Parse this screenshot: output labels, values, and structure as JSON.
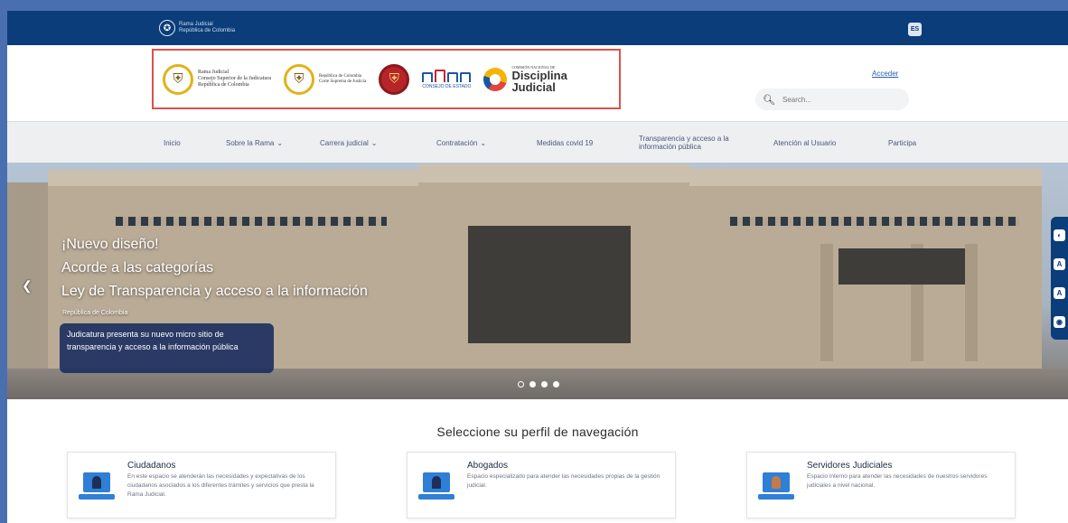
{
  "topbar": {
    "gov_logo_line1": "Rama Judicial",
    "gov_logo_line2": "República de Colombia",
    "lang": "ES"
  },
  "header": {
    "logo1_line1": "Rama Judicial",
    "logo1_line2": "Consejo Superior de la Judicatura",
    "logo1_line3": "República de Colombia",
    "logo2_line1": "República de Colombia",
    "logo2_line2": "Corte Suprema de Justicia",
    "logo4_text": "CONSEJO DE ESTADO",
    "logo5_small": "COMISIÓN NACIONAL DE",
    "logo5_big1": "Disciplina",
    "logo5_big2": "Judicial",
    "acceder": "Acceder",
    "search_placeholder": "Search..."
  },
  "nav": {
    "items": [
      {
        "label": "Inicio",
        "dropdown": false
      },
      {
        "label": "Sobre la Rama",
        "dropdown": true
      },
      {
        "label": "Carrera judicial",
        "dropdown": true
      },
      {
        "label": "Contratación",
        "dropdown": true
      },
      {
        "label": "Medidas covid 19",
        "dropdown": false
      },
      {
        "label": "Transparencia y acceso a la información pública",
        "dropdown": false
      },
      {
        "label": "Atención al Usuario",
        "dropdown": false
      },
      {
        "label": "Participa",
        "dropdown": false
      }
    ]
  },
  "hero": {
    "line1": "¡Nuevo diseño!",
    "line2": "Acorde a las categorías",
    "line3": "Ley de Transparencia y acceso a la información",
    "subtitle": "República de Colombia",
    "card_text": "Judicatura presenta su nuevo micro sitio de transparencia y acceso a la información pública",
    "slides_total": 4,
    "slide_active": 1
  },
  "profiles": {
    "title": "Seleccione su perfil de navegación",
    "cards": [
      {
        "title": "Ciudadanos",
        "desc": "En este espacio se atenderán las necesidades y expectativas de los ciudadanos asociados a los diferentes trámites y servicios que presta la Rama Judicial."
      },
      {
        "title": "Abogados",
        "desc": "Espacio especializado para atender las necesidades propias de la gestión judicial."
      },
      {
        "title": "Servidores Judiciales",
        "desc": "Espacio interno para atender las necesidades de nuestros servidores judiciales a nivel nacional."
      }
    ]
  },
  "colors": {
    "brand_blue": "#0b3d7a",
    "accent_red": "#d9534f",
    "link_blue": "#2a5db0"
  }
}
